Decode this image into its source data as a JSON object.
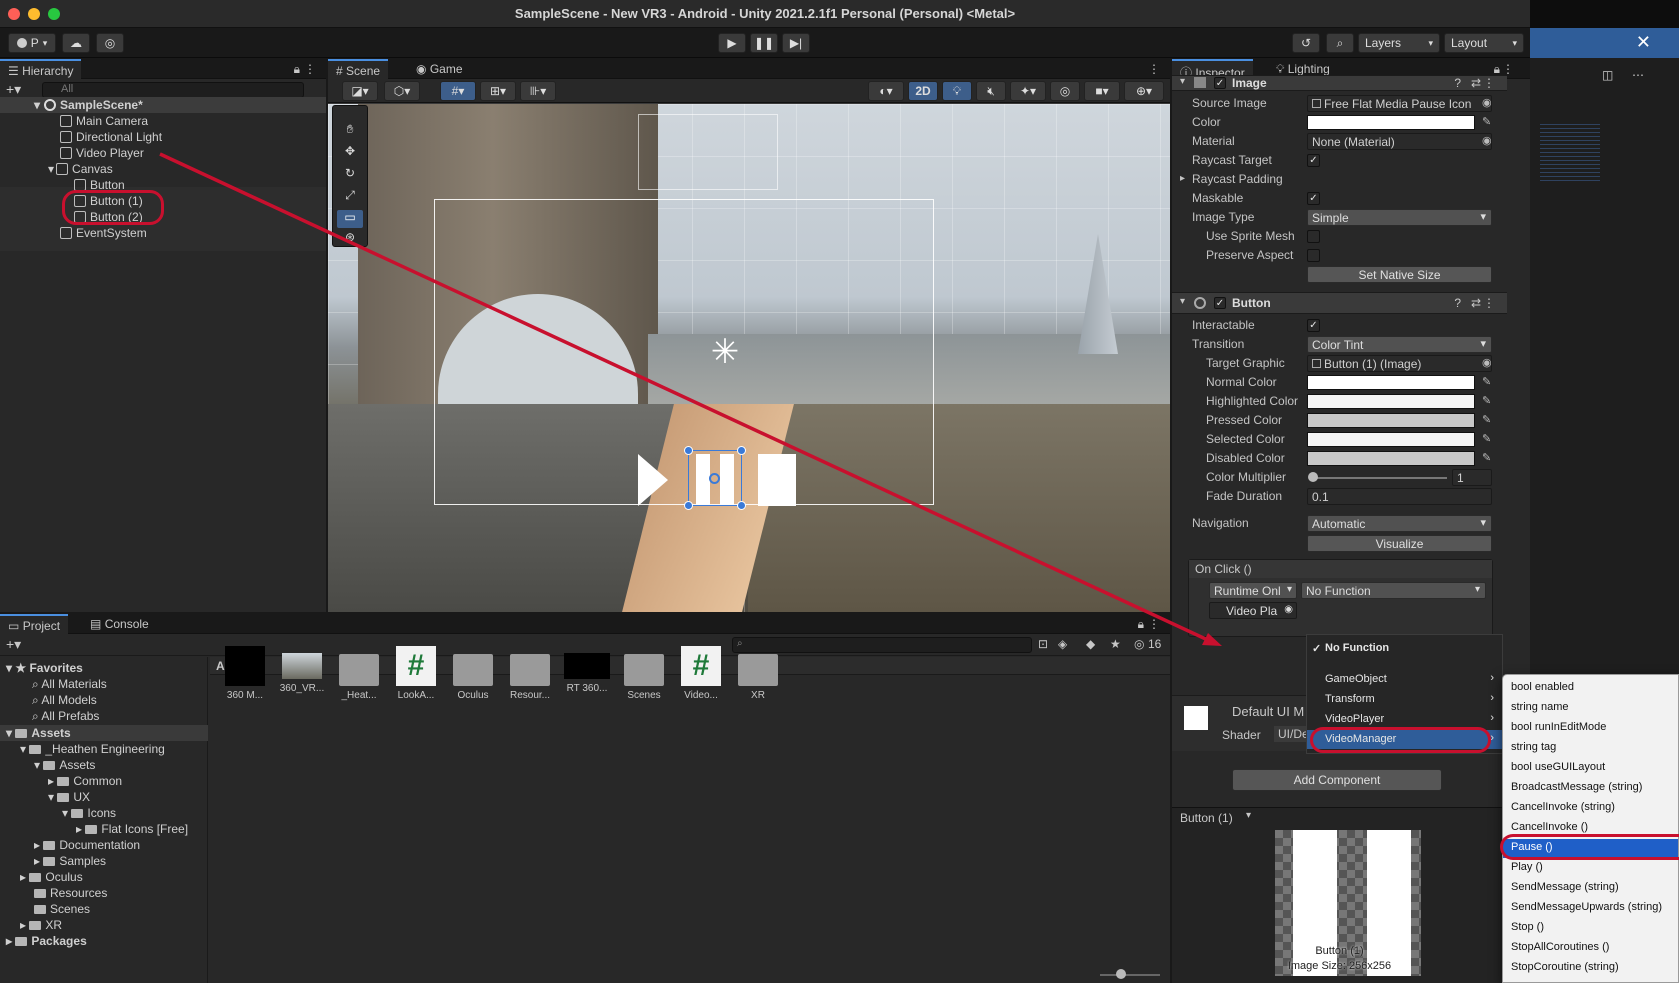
{
  "window": {
    "title": "SampleScene - New VR3 - Android - Unity 2021.2.1f1 Personal (Personal) <Metal>"
  },
  "toolbar": {
    "account": "P",
    "layers": "Layers",
    "layout": "Layout"
  },
  "hierarchy": {
    "tab": "Hierarchy",
    "search_placeholder": "All",
    "items": [
      {
        "label": "SampleScene*"
      },
      {
        "label": "Main Camera"
      },
      {
        "label": "Directional Light"
      },
      {
        "label": "Video Player"
      },
      {
        "label": "Canvas"
      },
      {
        "label": "Button"
      },
      {
        "label": "Button (1)"
      },
      {
        "label": "Button (2)"
      },
      {
        "label": "EventSystem"
      }
    ]
  },
  "scene": {
    "tabs": [
      {
        "label": "Scene"
      },
      {
        "label": "Game"
      }
    ],
    "mode_2d": "2D"
  },
  "inspector": {
    "tabs": [
      {
        "label": "Inspector"
      },
      {
        "label": "Lighting"
      }
    ],
    "image_component": {
      "title": "Image",
      "rows": [
        {
          "label": "Source Image",
          "value": "Free Flat Media Pause Icon"
        },
        {
          "label": "Color",
          "value": ""
        },
        {
          "label": "Material",
          "value": "None (Material)"
        },
        {
          "label": "Raycast Target",
          "value": "✓"
        },
        {
          "label": "Raycast Padding",
          "value": ""
        },
        {
          "label": "Maskable",
          "value": "✓"
        },
        {
          "label": "Image Type",
          "value": "Simple"
        },
        {
          "label": "Use Sprite Mesh",
          "value": ""
        },
        {
          "label": "Preserve Aspect",
          "value": ""
        }
      ],
      "set_native_size": "Set Native Size"
    },
    "button_component": {
      "title": "Button",
      "interactable_label": "Interactable",
      "transition_label": "Transition",
      "transition_value": "Color Tint",
      "target_graphic_label": "Target Graphic",
      "target_graphic_value": "Button (1) (Image)",
      "normal_color": "Normal Color",
      "highlighted_color": "Highlighted Color",
      "pressed_color": "Pressed Color",
      "selected_color": "Selected Color",
      "disabled_color": "Disabled Color",
      "color_multiplier_label": "Color Multiplier",
      "color_multiplier_value": "1",
      "fade_duration_label": "Fade Duration",
      "fade_duration_value": "0.1",
      "navigation_label": "Navigation",
      "navigation_value": "Automatic",
      "visualize": "Visualize",
      "on_click": "On Click ()",
      "runtime": "Runtime Onl",
      "function": "No Function",
      "object": "Video Pla"
    },
    "material": {
      "name": "Default UI M",
      "shader_label": "Shader",
      "shader_value": "UI/De"
    },
    "add_component": "Add Component",
    "preview_title": "Button (1)",
    "preview_caption_1": "Button (1)",
    "preview_caption_2": "Image Size: 256x256"
  },
  "function_menu": {
    "items": [
      {
        "label": "No Function",
        "check": "✓"
      },
      {
        "label": "GameObject"
      },
      {
        "label": "Transform"
      },
      {
        "label": "VideoPlayer"
      },
      {
        "label": "VideoManager"
      }
    ]
  },
  "method_menu": {
    "items": [
      {
        "label": "bool enabled"
      },
      {
        "label": "string name"
      },
      {
        "label": "bool runInEditMode"
      },
      {
        "label": "string tag"
      },
      {
        "label": "bool useGUILayout"
      },
      {
        "label": "BroadcastMessage (string)"
      },
      {
        "label": "CancelInvoke (string)"
      },
      {
        "label": "CancelInvoke ()"
      },
      {
        "label": "Pause ()"
      },
      {
        "label": "Play ()"
      },
      {
        "label": "SendMessage (string)"
      },
      {
        "label": "SendMessageUpwards (string)"
      },
      {
        "label": "Stop ()"
      },
      {
        "label": "StopAllCoroutines ()"
      },
      {
        "label": "StopCoroutine (string)"
      }
    ]
  },
  "project": {
    "tabs": [
      {
        "label": "Project"
      },
      {
        "label": "Console"
      }
    ],
    "badge": "16",
    "breadcrumb": "Assets",
    "tree": [
      {
        "label": "Favorites"
      },
      {
        "label": "All Materials"
      },
      {
        "label": "All Models"
      },
      {
        "label": "All Prefabs"
      },
      {
        "label": "Assets"
      },
      {
        "label": "_Heathen Engineering"
      },
      {
        "label": "Assets"
      },
      {
        "label": "Common"
      },
      {
        "label": "UX"
      },
      {
        "label": "Icons"
      },
      {
        "label": "Flat Icons [Free]"
      },
      {
        "label": "Documentation"
      },
      {
        "label": "Samples"
      },
      {
        "label": "Oculus"
      },
      {
        "label": "Resources"
      },
      {
        "label": "Scenes"
      },
      {
        "label": "XR"
      },
      {
        "label": "Packages"
      }
    ],
    "assets": [
      {
        "label": "360 M..."
      },
      {
        "label": "360_VR..."
      },
      {
        "label": "_Heat..."
      },
      {
        "label": "LookA..."
      },
      {
        "label": "Oculus"
      },
      {
        "label": "Resour..."
      },
      {
        "label": "RT 360..."
      },
      {
        "label": "Scenes"
      },
      {
        "label": "Video..."
      },
      {
        "label": "XR"
      }
    ]
  },
  "colors": {
    "accent": "#4a8fe0",
    "annotation": "#c8102e",
    "selection": "#2f5d99"
  }
}
